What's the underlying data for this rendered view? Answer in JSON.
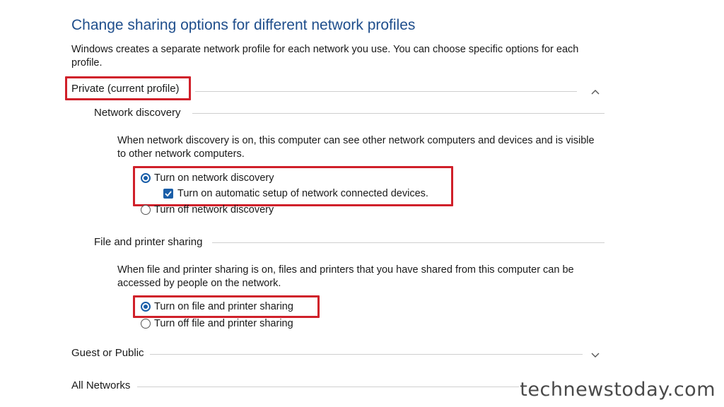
{
  "header": {
    "title": "Change sharing options for different network profiles",
    "description": "Windows creates a separate network profile for each network you use. You can choose specific options for each profile."
  },
  "private": {
    "label": "Private (current profile)",
    "network_discovery": {
      "label": "Network discovery",
      "description": "When network discovery is on, this computer can see other network computers and devices and is visible to other network computers.",
      "option_on": "Turn on network discovery",
      "auto_setup": "Turn on automatic setup of network connected devices.",
      "option_off": "Turn off network discovery"
    },
    "file_sharing": {
      "label": "File and printer sharing",
      "description": "When file and printer sharing is on, files and printers that you have shared from this computer can be accessed by people on the network.",
      "option_on": "Turn on file and printer sharing",
      "option_off": "Turn off file and printer sharing"
    }
  },
  "guest_public": {
    "label": "Guest or Public"
  },
  "all_networks": {
    "label": "All Networks"
  },
  "watermark": "technewstoday.com",
  "colors": {
    "title_blue": "#1f4e8c",
    "accent": "#1a5ea8",
    "highlight_red": "#d0202a"
  },
  "state": {
    "network_discovery_selected": "on",
    "auto_setup_checked": true,
    "file_sharing_selected": "on",
    "private_expanded": true,
    "guest_public_expanded": false,
    "all_networks_expanded": false
  }
}
